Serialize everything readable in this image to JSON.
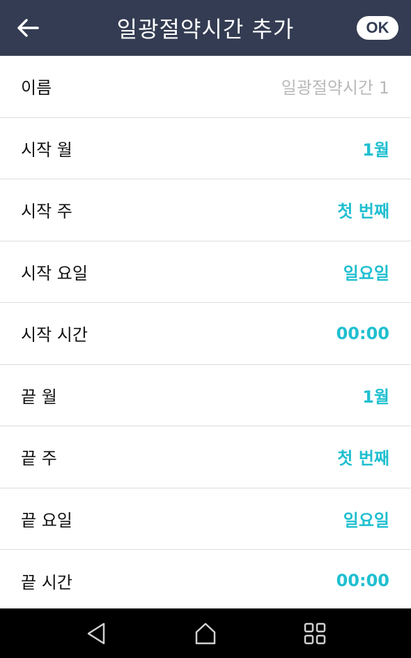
{
  "header": {
    "title": "일광절약시간 추가",
    "back_icon": "arrow-left-icon",
    "ok_label": "OK"
  },
  "colors": {
    "header_bg": "#333c52",
    "accent": "#1fbfd0",
    "placeholder": "#b9b9b9"
  },
  "fields": [
    {
      "label": "이름",
      "value": "일광절약시간 1"
    },
    {
      "label": "시작 월",
      "value": "1월"
    },
    {
      "label": "시작 주",
      "value": "첫 번째"
    },
    {
      "label": "시작 요일",
      "value": "일요일"
    },
    {
      "label": "시작 시간",
      "value": "00:00"
    },
    {
      "label": "끝 월",
      "value": "1월"
    },
    {
      "label": "끝 주",
      "value": "첫 번째"
    },
    {
      "label": "끝 요일",
      "value": "일요일"
    },
    {
      "label": "끝 시간",
      "value": "00:00"
    }
  ],
  "navbar": {
    "back_icon": "triangle-back-icon",
    "home_icon": "home-icon",
    "recents_icon": "grid-recents-icon"
  }
}
